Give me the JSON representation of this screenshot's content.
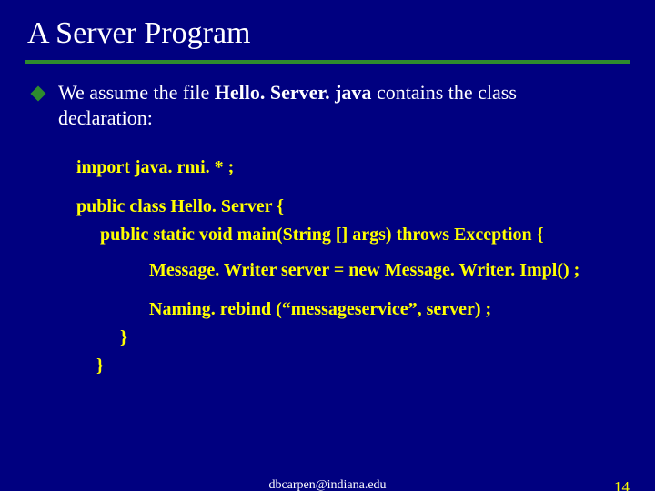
{
  "title": "A Server Program",
  "bullet": {
    "pre": "We assume the file ",
    "file": "Hello. Server. java",
    "post": " contains the class declaration:"
  },
  "code": {
    "l1": "import java. rmi. * ;",
    "l2": "public class Hello. Server {",
    "l3": "public static void main(String [] args) throws Exception {",
    "l4": "Message. Writer server = new Message. Writer. Impl() ;",
    "l5": "Naming. rebind (“messageservice”, server) ;",
    "l6": "}",
    "l7": "}"
  },
  "footer": {
    "email": "dbcarpen@indiana.edu",
    "page": "14"
  }
}
